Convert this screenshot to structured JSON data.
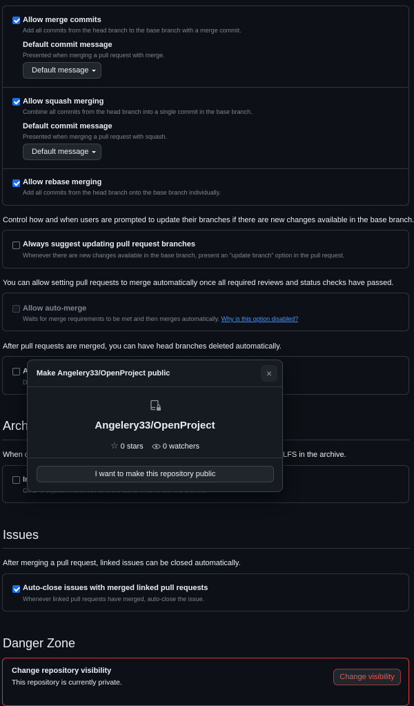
{
  "merge_box": {
    "merge_commits": {
      "checked": true,
      "label": "Allow merge commits",
      "description": "Add all commits from the head branch to the base branch with a merge commit.",
      "default_title": "Default commit message",
      "default_desc": "Presented when merging a pull request with merge.",
      "button": "Default message"
    },
    "squash": {
      "checked": true,
      "label": "Allow squash merging",
      "description": "Combine all commits from the head branch into a single commit in the base branch.",
      "default_title": "Default commit message",
      "default_desc": "Presented when merging a pull request with squash.",
      "button": "Default message"
    },
    "rebase": {
      "checked": true,
      "label": "Allow rebase merging",
      "description": "Add all commits from the head branch onto the base branch individually."
    }
  },
  "update_branch": {
    "intro": "Control how and when users are prompted to update their branches if there are new changes available in the base branch.",
    "label": "Always suggest updating pull request branches",
    "description": "Whenever there are new changes available in the base branch, present an “update branch” option in the pull request.",
    "checked": false
  },
  "auto_merge": {
    "intro": "You can allow setting pull requests to merge automatically once all required reviews and status checks have passed.",
    "label": "Allow auto-merge",
    "description": "Waits for merge requirements to be met and then merges automatically.",
    "link": "Why is this option disabled?",
    "checked": false
  },
  "delete_branches": {
    "intro": "After pull requests are merged, you can have head branches deleted automatically.",
    "label_partial": "A",
    "desc_partial": "D"
  },
  "archives": {
    "heading_partial": "Arch",
    "intro_left": "When c",
    "intro_right": "LFS in the archive.",
    "label_partial": "In",
    "desc_partial": "Git LFS objects in archives to ... the same ... as ... with the archive."
  },
  "issues": {
    "heading": "Issues",
    "intro": "After merging a pull request, linked issues can be closed automatically.",
    "label": "Auto-close issues with merged linked pull requests",
    "description": "Whenever linked pull requests have merged, auto-close the issue.",
    "checked": true
  },
  "danger": {
    "heading": "Danger Zone",
    "visibility_title": "Change repository visibility",
    "visibility_desc": "This repository is currently private.",
    "visibility_button": "Change visibility"
  },
  "modal": {
    "title": "Make Angelery33/OpenProject public",
    "close": "×",
    "repo_name": "Angelery33/OpenProject",
    "stars": "0 stars",
    "watchers": "0 watchers",
    "confirm_button": "I want to make this repository public"
  },
  "colors": {
    "background": "#0d1117",
    "border": "#30363d",
    "accent": "#1f6feb",
    "link": "#4493f8",
    "danger": "#f85149"
  }
}
